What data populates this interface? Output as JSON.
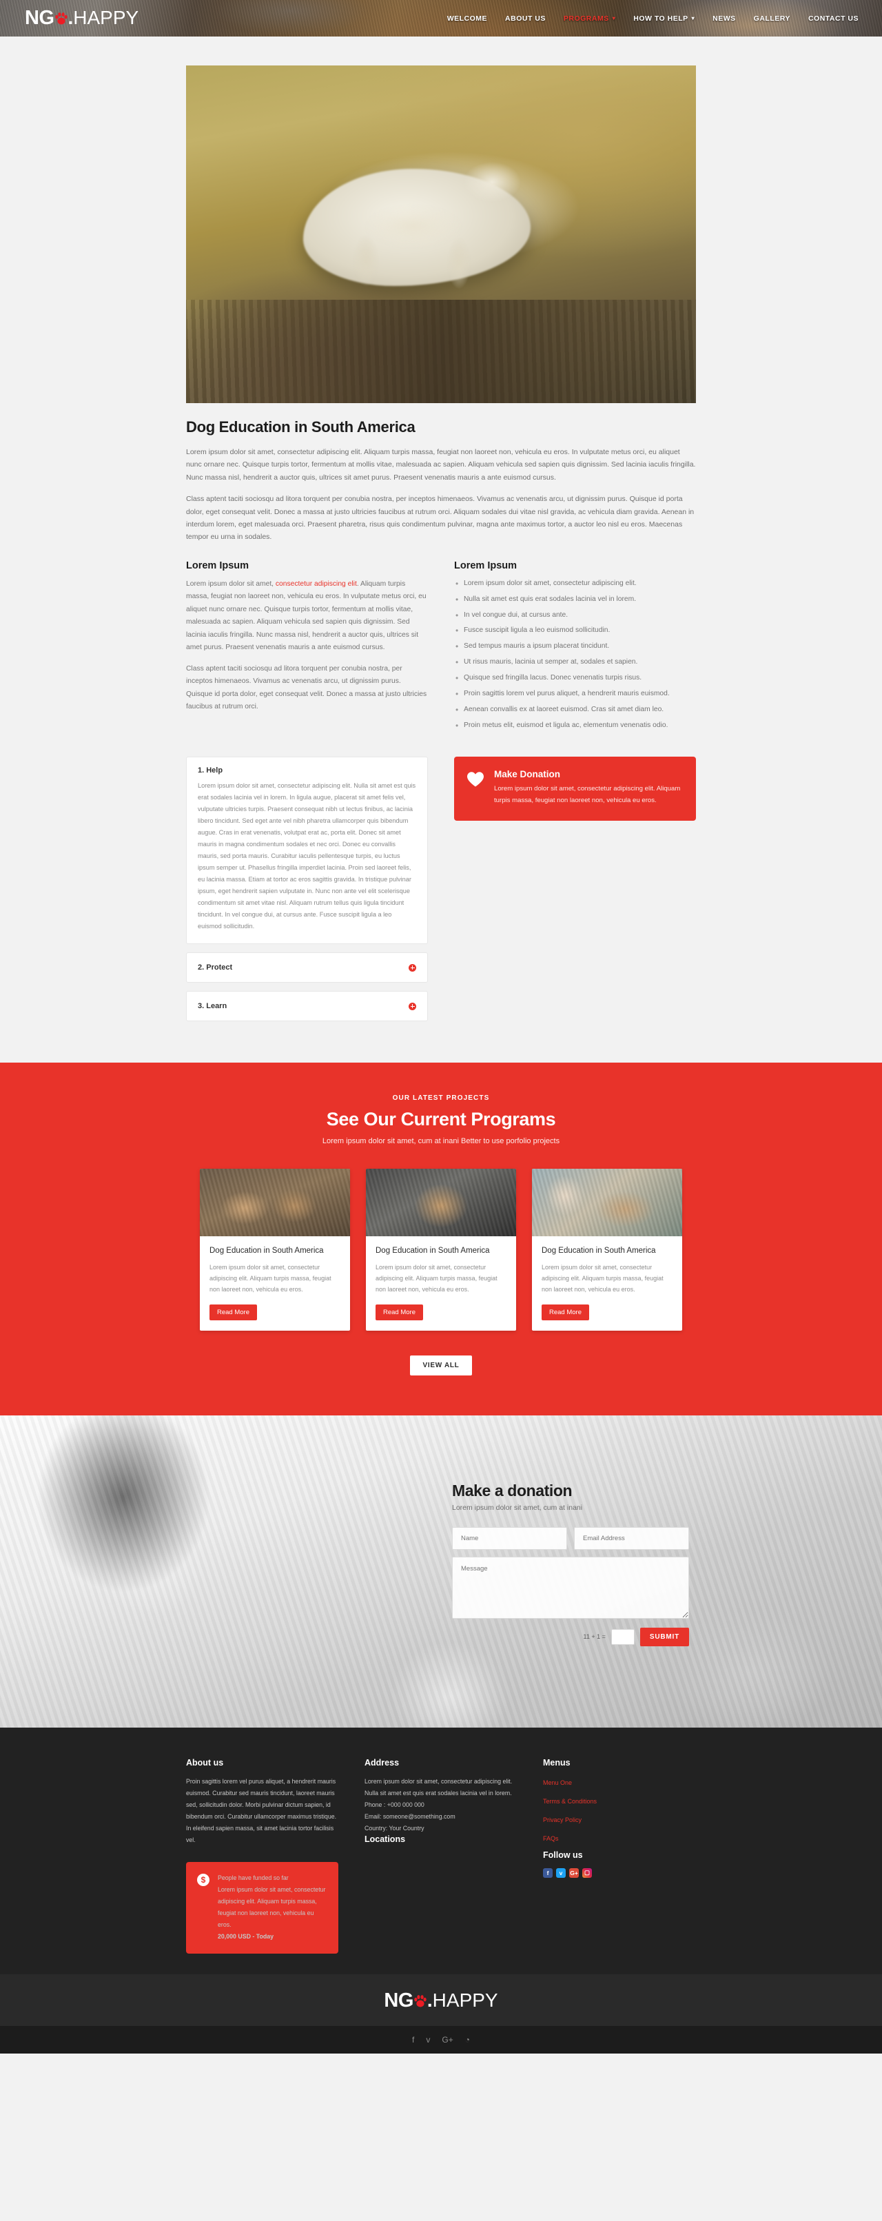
{
  "brand": {
    "name_part1": "NG",
    "paw_icon": "paw-print-icon",
    "dot": ".",
    "name_part2": "HAPPY",
    "accent_color": "#e8332a"
  },
  "nav": {
    "items": [
      {
        "label": "WELCOME",
        "active": false,
        "caret": false
      },
      {
        "label": "ABOUT US",
        "active": false,
        "caret": false
      },
      {
        "label": "PROGRAMS",
        "active": true,
        "caret": true
      },
      {
        "label": "HOW TO HELP",
        "active": false,
        "caret": true
      },
      {
        "label": "NEWS",
        "active": false,
        "caret": false
      },
      {
        "label": "GALLERY",
        "active": false,
        "caret": false
      },
      {
        "label": "CONTACT US",
        "active": false,
        "caret": false
      }
    ],
    "caret_glyph": "▾"
  },
  "article": {
    "title": "Dog Education in South America",
    "p1": "Lorem ipsum dolor sit amet, consectetur adipiscing elit. Aliquam turpis massa, feugiat non laoreet non, vehicula eu eros. In vulputate metus orci, eu aliquet nunc ornare nec. Quisque turpis tortor, fermentum at mollis vitae, malesuada ac sapien. Aliquam vehicula sed sapien quis dignissim. Sed lacinia iaculis fringilla. Nunc massa nisl, hendrerit a auctor quis, ultrices sit amet purus. Praesent venenatis mauris a ante euismod cursus.",
    "p2": "Class aptent taciti sociosqu ad litora torquent per conubia nostra, per inceptos himenaeos. Vivamus ac venenatis arcu, ut dignissim purus. Quisque id porta dolor, eget consequat velit. Donec a massa at justo ultricies faucibus at rutrum orci. Aliquam sodales dui vitae nisl gravida, ac vehicula diam gravida. Aenean in interdum lorem, eget malesuada orci. Praesent pharetra, risus quis condimentum pulvinar, magna ante maximus tortor, a auctor leo nisl eu eros. Maecenas tempor eu urna in sodales."
  },
  "left_column": {
    "heading": "Lorem Ipsum",
    "p1_before": "Lorem ipsum dolor sit amet, ",
    "p1_highlight": "consectetur adipiscing elit",
    "p1_after": ". Aliquam turpis massa, feugiat non laoreet non, vehicula eu eros. In vulputate metus orci, eu aliquet nunc ornare nec. Quisque turpis tortor, fermentum at mollis vitae, malesuada ac sapien. Aliquam vehicula sed sapien quis dignissim. Sed lacinia iaculis fringilla. Nunc massa nisl, hendrerit a auctor quis, ultrices sit amet purus. Praesent venenatis mauris a ante euismod cursus.",
    "p2": "Class aptent taciti sociosqu ad litora torquent per conubia nostra, per inceptos himenaeos. Vivamus ac venenatis arcu, ut dignissim purus. Quisque id porta dolor, eget consequat velit. Donec a massa at justo ultricies faucibus at rutrum orci."
  },
  "right_column": {
    "heading": "Lorem Ipsum",
    "bullets": [
      "Lorem ipsum dolor sit amet, consectetur adipiscing elit.",
      "Nulla sit amet est quis erat sodales lacinia vel in lorem.",
      "In vel congue dui, at cursus ante.",
      "Fusce suscipit ligula a leo euismod sollicitudin.",
      "Sed tempus mauris a ipsum placerat tincidunt.",
      "Ut risus mauris, lacinia ut semper at, sodales et sapien.",
      "Quisque sed fringilla lacus. Donec venenatis turpis risus.",
      "Proin sagittis lorem vel purus aliquet, a hendrerit mauris euismod.",
      "Aenean convallis ex at laoreet euismod. Cras sit amet diam leo.",
      "Proin metus elit, euismod et ligula ac, elementum venenatis odio."
    ]
  },
  "accordion": {
    "items": [
      {
        "label": "1. Help",
        "open": true,
        "body": "Lorem ipsum dolor sit amet, consectetur adipiscing elit. Nulla sit amet est quis erat sodales lacinia vel in lorem. In ligula augue, placerat sit amet felis vel, vulputate ultricies turpis. Praesent consequat nibh ut lectus finibus, ac lacinia libero tincidunt. Sed eget ante vel nibh pharetra ullamcorper quis bibendum augue. Cras in erat venenatis, volutpat erat ac, porta elit. Donec sit amet mauris in magna condimentum sodales et nec orci. Donec eu convallis mauris, sed porta mauris. Curabitur iaculis pellentesque turpis, eu luctus ipsum semper ut. Phasellus fringilla imperdiet lacinia. Proin sed laoreet felis, eu lacinia massa. Etiam at tortor ac eros sagittis gravida. In tristique pulvinar ipsum, eget hendrerit sapien vulputate in. Nunc non ante vel elit scelerisque condimentum sit amet vitae nisl. Aliquam rutrum tellus quis ligula tincidunt tincidunt. In vel congue dui, at cursus ante. Fusce suscipit ligula a leo euismod sollicitudin."
      },
      {
        "label": "2. Protect",
        "open": false,
        "body": ""
      },
      {
        "label": "3. Learn",
        "open": false,
        "body": ""
      }
    ]
  },
  "donation_promo": {
    "icon": "heart-icon",
    "title": "Make Donation",
    "text": "Lorem ipsum dolor sit amet, consectetur adipiscing elit. Aliquam turpis massa, feugiat non laoreet non, vehicula eu eros."
  },
  "programs": {
    "kicker": "OUR LATEST PROJECTS",
    "title": "See Our Current Programs",
    "subtitle": "Lorem ipsum dolor sit amet, cum at inani Better to use porfolio projects",
    "view_all_label": "VIEW ALL",
    "cards": [
      {
        "title": "Dog Education in South America",
        "text": "Lorem ipsum dolor sit amet, consectetur adipiscing elit. Aliquam turpis massa, feugiat non laoreet non, vehicula eu eros.",
        "button": "Read More"
      },
      {
        "title": "Dog Education in South America",
        "text": "Lorem ipsum dolor sit amet, consectetur adipiscing elit. Aliquam turpis massa, feugiat non laoreet non, vehicula eu eros.",
        "button": "Read More"
      },
      {
        "title": "Dog Education in South America",
        "text": "Lorem ipsum dolor sit amet, consectetur adipiscing elit. Aliquam turpis massa, feugiat non laoreet non, vehicula eu eros.",
        "button": "Read More"
      }
    ]
  },
  "donation_form": {
    "title": "Make a donation",
    "subtitle": "Lorem ipsum dolor sit amet, cum at inani",
    "name_placeholder": "Name",
    "email_placeholder": "Email Address",
    "message_placeholder": "Message",
    "captcha_question": "11 + 1 =",
    "captcha_value": "",
    "submit_label": "SUBMIT"
  },
  "footer": {
    "about": {
      "heading": "About us",
      "text": "Proin sagittis lorem vel purus aliquet, a hendrerit mauris euismod. Curabitur sed mauris tincidunt, laoreet mauris sed, sollicitudin dolor. Morbi pulvinar dictum sapien, id bibendum orci. Curabitur ullamcorper maximus tristique. In eleifend sapien massa, sit amet lacinia tortor facilisis vel."
    },
    "fund_box": {
      "icon": "dollar-icon",
      "title": "People have funded so far",
      "text": "Lorem ipsum dolor sit amet, consectetur adipiscing elit. Aliquam turpis massa, feugiat non laoreet non, vehicula eu eros.",
      "amount": "20,000 USD - Today"
    },
    "address": {
      "heading": "Address",
      "text": "Lorem ipsum dolor sit amet, consectetur adipiscing elit. Nulla sit amet est quis erat sodales lacinia vel in lorem.",
      "phone": "Phone : +000 000 000",
      "email": "Email: someone@something.com",
      "country": "Country: Your Country"
    },
    "locations_heading": "Locations",
    "menus": {
      "heading": "Menus",
      "items": [
        "Menu One",
        "Terms & Conditions",
        "Privacy Policy",
        "FAQs"
      ]
    },
    "follow": {
      "heading": "Follow us",
      "socials": [
        {
          "name": "facebook-icon",
          "glyph": "f"
        },
        {
          "name": "twitter-icon",
          "glyph": "ᴠ"
        },
        {
          "name": "google-plus-icon",
          "glyph": "G+"
        },
        {
          "name": "instagram-icon",
          "glyph": "▢"
        }
      ]
    }
  },
  "bottom_bar": {
    "socials": [
      {
        "name": "facebook-icon",
        "glyph": "f"
      },
      {
        "name": "twitter-icon",
        "glyph": "ᴠ"
      },
      {
        "name": "google-plus-icon",
        "glyph": "G+"
      },
      {
        "name": "rss-icon",
        "glyph": "◔"
      }
    ]
  }
}
